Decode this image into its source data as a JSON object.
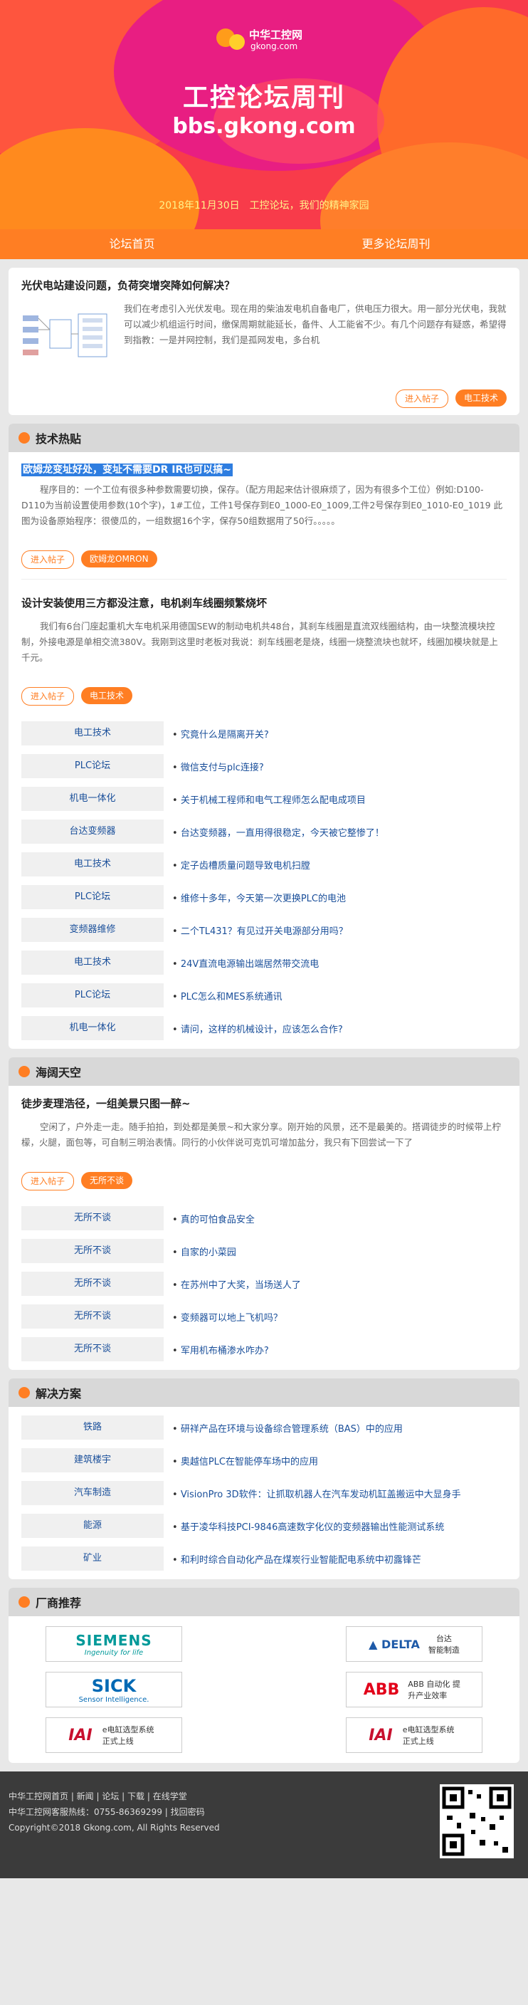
{
  "header": {
    "logo_cn": "中华工控网",
    "logo_url": "gkong.com",
    "title": "工控论坛周刊",
    "site_url": "bbs.gkong.com",
    "date_line": "2018年11月30日　工控论坛，我们的精神家园"
  },
  "nav": {
    "home": "论坛首页",
    "more": "更多论坛周刊"
  },
  "feature": {
    "title": "光伏电站建设问题，负荷突增突降如何解决？",
    "body": "我们在考虑引入光伏发电。现在用的柴油发电机自备电厂，供电压力很大。用一部分光伏电，我就可以减少机组运行时间，缴保周期就能延长，备件、人工能省不少。有几个问题存有疑惑，希望得到指教：一是并网控制，我们是孤网发电，多台机",
    "btn_enter": "进入帖子",
    "btn_tag": "电工技术"
  },
  "tech": {
    "heading": "技术热贴",
    "article1": {
      "title": "欧姆龙变址好处，变址不需要DR IR也可以搞~",
      "body": "程序目的：一个工位有很多种参数需要切换，保存。（配方用起来估计很麻烦了，因为有很多个工位）例如:D100-D110为当前设置使用参数(10个字)，1#工位，工件1号保存到E0_1000-E0_1009,工件2号保存到E0_1010-E0_1019 此图为设备原始程序：很傻瓜的，一组数据16个字，保存50组数据用了50行。。。。。",
      "btn_enter": "进入帖子",
      "btn_tag": "欧姆龙OMRON"
    },
    "article2": {
      "title": "设计安装使用三方都没注意，电机刹车线圈频繁烧坏",
      "body": "我们有6台门座起重机大车电机采用德国SEW的制动电机共48台，其刹车线圈是直流双线圈结构，由一块整流模块控制，外接电源是单相交流380V。我刚到这里时老板对我说：刹车线圈老是烧，线圈一烧整流块也就坏，线圈加模块就是上千元。",
      "btn_enter": "进入帖子",
      "btn_tag": "电工技术"
    },
    "rows": [
      {
        "cat": "电工技术",
        "item": "究竟什么是隔离开关?"
      },
      {
        "cat": "PLC论坛",
        "item": "微信支付与plc连接?"
      },
      {
        "cat": "机电一体化",
        "item": "关于机械工程师和电气工程师怎么配电成项目"
      },
      {
        "cat": "台达变频器",
        "item": "台达变频器，一直用得很稳定，今天被它整惨了！"
      },
      {
        "cat": "电工技术",
        "item": "定子齿槽质量问题导致电机扫膛"
      },
      {
        "cat": "PLC论坛",
        "item": "维修十多年，今天第一次更换PLC的电池"
      },
      {
        "cat": "变频器维修",
        "item": "二个TL431？有见过开关电源部分用吗？"
      },
      {
        "cat": "电工技术",
        "item": "24V直流电源输出端居然带交流电"
      },
      {
        "cat": "PLC论坛",
        "item": "PLC怎么和MES系统通讯"
      },
      {
        "cat": "机电一体化",
        "item": "请问，这样的机械设计，应该怎么合作?"
      }
    ]
  },
  "sky": {
    "heading": "海阔天空",
    "article": {
      "title": "徒步麦理浩径，一组美景只图一醉~",
      "body": "空闲了，户外走一走。随手拍拍，到处都是美景~和大家分享。刚开始的风景，还不是最美的。搭调徒步的时候带上柠檬，火腿，面包等，可自制三明治表情。同行的小伙伴说可克饥可增加盐分，我只有下回尝试一下了",
      "btn_enter": "进入帖子",
      "btn_tag": "无所不谈"
    },
    "rows": [
      {
        "cat": "无所不谈",
        "item": "真的可怕食品安全"
      },
      {
        "cat": "无所不谈",
        "item": "自家的小菜园"
      },
      {
        "cat": "无所不谈",
        "item": "在苏州中了大奖，当场送人了"
      },
      {
        "cat": "无所不谈",
        "item": "变频器可以地上飞机吗？"
      },
      {
        "cat": "无所不谈",
        "item": "军用机布桶渗水咋办?"
      }
    ]
  },
  "solutions": {
    "heading": "解决方案",
    "rows": [
      {
        "cat": "铁路",
        "item": "研祥产品在环境与设备综合管理系统（BAS）中的应用"
      },
      {
        "cat": "建筑楼宇",
        "item": "奥越信PLC在智能停车场中的应用"
      },
      {
        "cat": "汽车制造",
        "item": "VisionPro 3D软件：让抓取机器人在汽车发动机缸盖搬运中大显身手"
      },
      {
        "cat": "能源",
        "item": "基于凌华科技PCI-9846高速数字化仪的变频器输出性能测试系统"
      },
      {
        "cat": "矿业",
        "item": "和利时综合自动化产品在煤炭行业智能配电系统中初露锋芒"
      }
    ]
  },
  "brands": {
    "heading": "厂商推荐",
    "items": [
      {
        "name": "SIEMENS",
        "sub": "Ingenuity for life",
        "color": "#009999"
      },
      {
        "name": "台达",
        "sub": "智能制造",
        "color": "#1e5aa8"
      },
      {
        "name": "SICK",
        "sub": "Sensor Intelligence.",
        "color": "#0069b4"
      },
      {
        "name": "ABB",
        "sub": "ABB 自动化 提升产业效率",
        "color": "#e2001a"
      },
      {
        "name": "IAI",
        "sub": "e电缸选型系统正式上线",
        "color": "#c8102e"
      },
      {
        "name": "IAI",
        "sub": "e电缸选型系统正式上线",
        "color": "#c8102e"
      }
    ]
  },
  "footer": {
    "line1": "中华工控网首页 | 新闻 | 论坛 | 下载 | 在线学堂",
    "line2": "中华工控网客服热线：0755-86369299 | 找回密码",
    "line3": "Copyright©2018 Gkong.com, All Rights Reserved"
  }
}
